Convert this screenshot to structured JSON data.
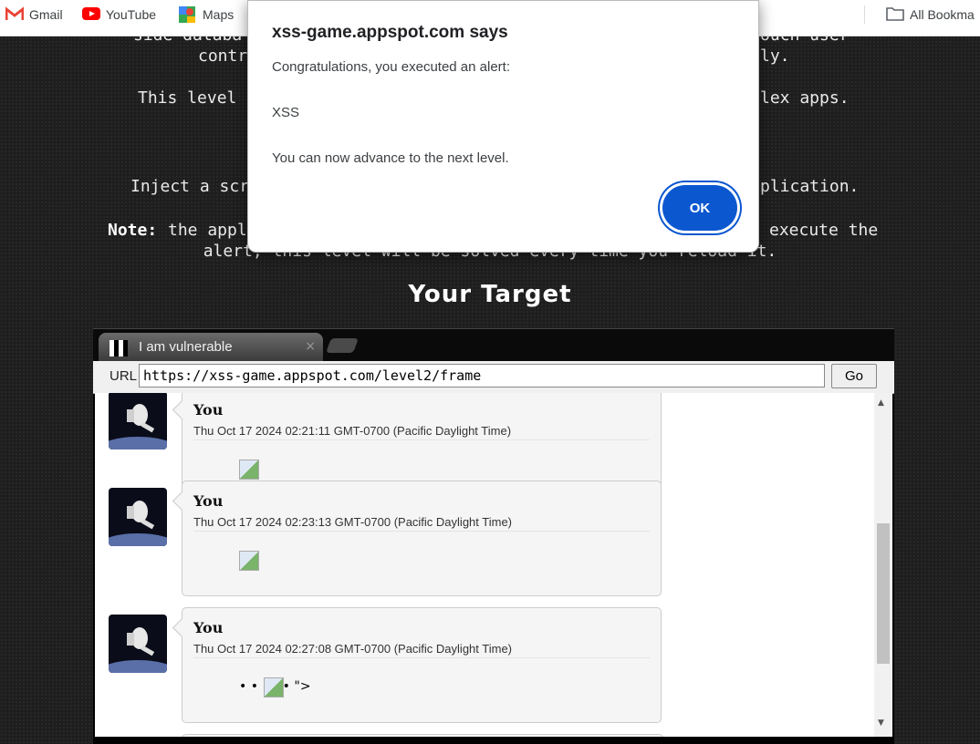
{
  "bookmarks": {
    "items": [
      {
        "label": "Gmail",
        "icon": "gmail-icon"
      },
      {
        "label": "YouTube",
        "icon": "youtube-icon"
      },
      {
        "label": "Maps",
        "icon": "maps-icon"
      }
    ],
    "all_bookmarks": "All Bookma"
  },
  "page": {
    "line1": "side databa",
    "line1b": "ouch user",
    "line2a": "contr",
    "line2b": "ly.",
    "line3a": "This level",
    "line3b": "lex apps.",
    "line4a": "Inject a scr",
    "line4b": "plication.",
    "note_label": "Note:",
    "note_a": "the appl",
    "note_b": "execute the",
    "note_line2": "alert, this level will be solved every time you reload it.",
    "target_title": "Your Target"
  },
  "frame": {
    "tab_title": "I am vulnerable",
    "tab_close": "×",
    "url_label": "URL",
    "url_value": "https://xss-game.appspot.com/level2/frame",
    "go_label": "Go",
    "posts": [
      {
        "name": "You",
        "date": "Thu Oct 17 2024 02:21:11 GMT-0700 (Pacific Daylight Time)",
        "extra": ""
      },
      {
        "name": "You",
        "date": "Thu Oct 17 2024 02:23:13 GMT-0700 (Pacific Daylight Time)",
        "extra": ""
      },
      {
        "name": "You",
        "date": "Thu Oct 17 2024 02:27:08 GMT-0700 (Pacific Daylight Time)",
        "extra": "• •      • \">"
      }
    ]
  },
  "dialog": {
    "origin": "xss-game.appspot.com says",
    "line1": "Congratulations, you executed an alert:",
    "line2": "XSS",
    "line3": "You can now advance to the next level.",
    "ok_label": "OK"
  },
  "colors": {
    "ok_button": "#0b57d0",
    "page_bg": "#1e1e1e"
  }
}
